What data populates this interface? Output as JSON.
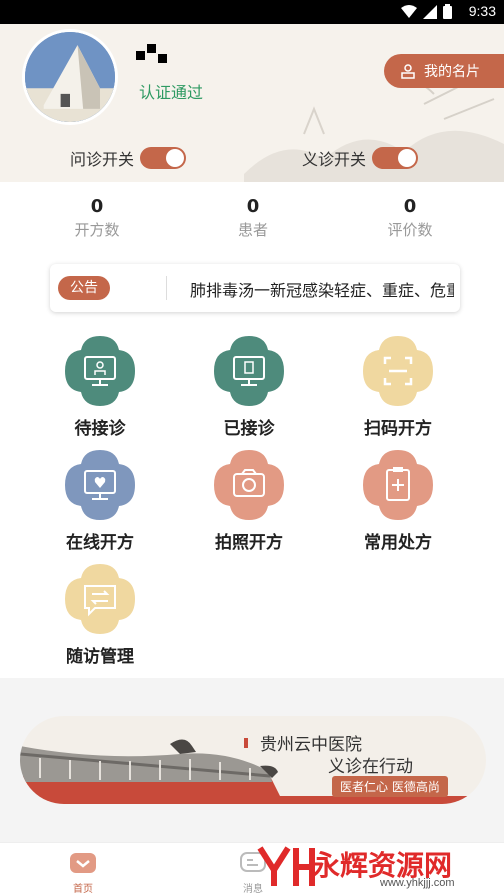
{
  "status_bar": {
    "time": "9:33"
  },
  "profile": {
    "certification": "认证通过",
    "card_button": "我的名片"
  },
  "toggles": [
    {
      "label": "问诊开关",
      "on": true
    },
    {
      "label": "义诊开关",
      "on": true
    }
  ],
  "stats": [
    {
      "value": "0",
      "label": "开方数"
    },
    {
      "value": "0",
      "label": "患者"
    },
    {
      "value": "0",
      "label": "评价数"
    }
  ],
  "notice": {
    "tag": "公告",
    "text": "肺排毒汤一新冠感染轻症、重症、危重症"
  },
  "functions": [
    {
      "label": "待接诊",
      "icon": "monitor-doctor-icon",
      "color": "#4e8b7c"
    },
    {
      "label": "已接诊",
      "icon": "monitor-document-icon",
      "color": "#4e8b7c"
    },
    {
      "label": "扫码开方",
      "icon": "scan-icon",
      "color": "#f0d8a0"
    },
    {
      "label": "在线开方",
      "icon": "monitor-heart-icon",
      "color": "#7f97bd"
    },
    {
      "label": "拍照开方",
      "icon": "camera-icon",
      "color": "#e29a84"
    },
    {
      "label": "常用处方",
      "icon": "clipboard-plus-icon",
      "color": "#e29a84"
    },
    {
      "label": "随访管理",
      "icon": "message-transfer-icon",
      "color": "#f0d8a0"
    }
  ],
  "banner": {
    "title": "贵州云中医院",
    "subtitle": "义诊在行动",
    "slogan": "医者仁心  医德高尚"
  },
  "tabbar": [
    {
      "label": "首页",
      "active": true
    },
    {
      "label": "消息",
      "active": false
    }
  ],
  "watermark": {
    "text": "永辉资源网",
    "url": "www.yhkjjj.com"
  },
  "colors": {
    "accent": "#c4674a",
    "green": "#2e9a62"
  }
}
